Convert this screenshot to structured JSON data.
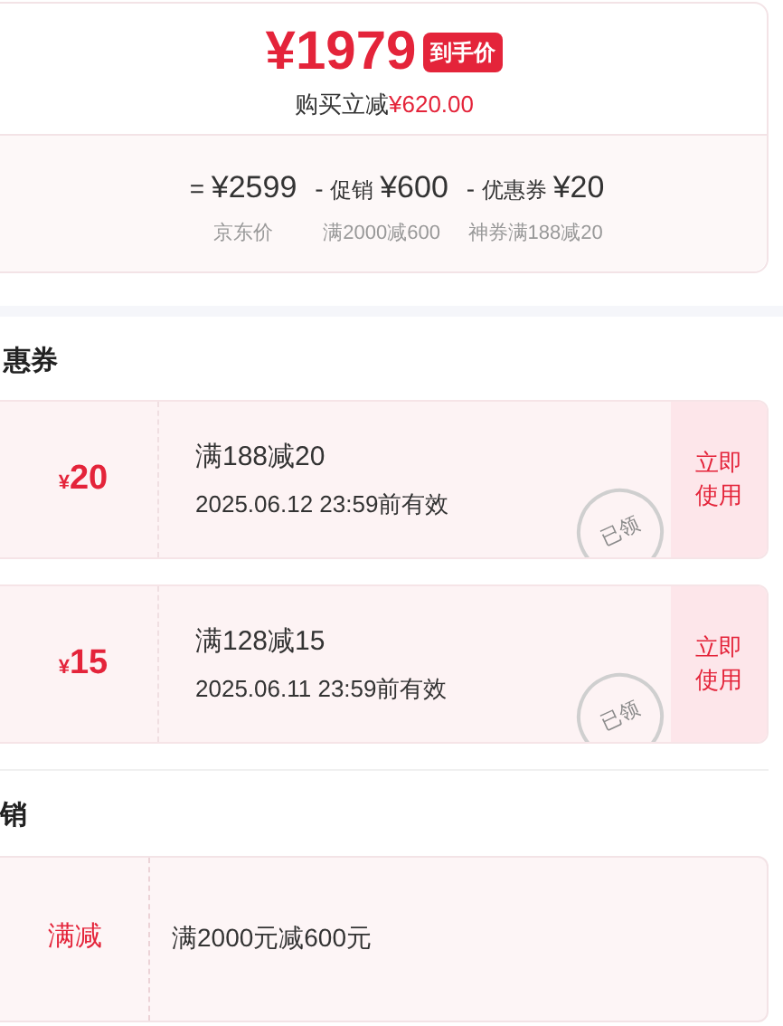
{
  "price": {
    "final": "¥1979",
    "badge": "到手价",
    "saving_label": "购买立减",
    "saving_amount": "¥620.00"
  },
  "breakdown": [
    {
      "operator": "=",
      "amount": "¥2599",
      "note": "京东价"
    },
    {
      "operator": "-",
      "label": "促销",
      "amount": "¥600",
      "note": "满2000减600"
    },
    {
      "operator": "-",
      "label": "优惠券",
      "amount": "¥20",
      "note": "神券满188减20"
    }
  ],
  "coupons_heading": "惠券",
  "coupons": [
    {
      "currency": "¥",
      "value": "20",
      "condition": "满188减20",
      "validity": "2025.06.12 23:59前有效",
      "action": "立即使用",
      "stamp": "已领"
    },
    {
      "currency": "¥",
      "value": "15",
      "condition": "满128减15",
      "validity": "2025.06.11 23:59前有效",
      "action": "立即使用",
      "stamp": "已领"
    }
  ],
  "promotions_heading": "销",
  "promotions": [
    {
      "tag": "满减",
      "description": "满2000元减600元"
    }
  ]
}
